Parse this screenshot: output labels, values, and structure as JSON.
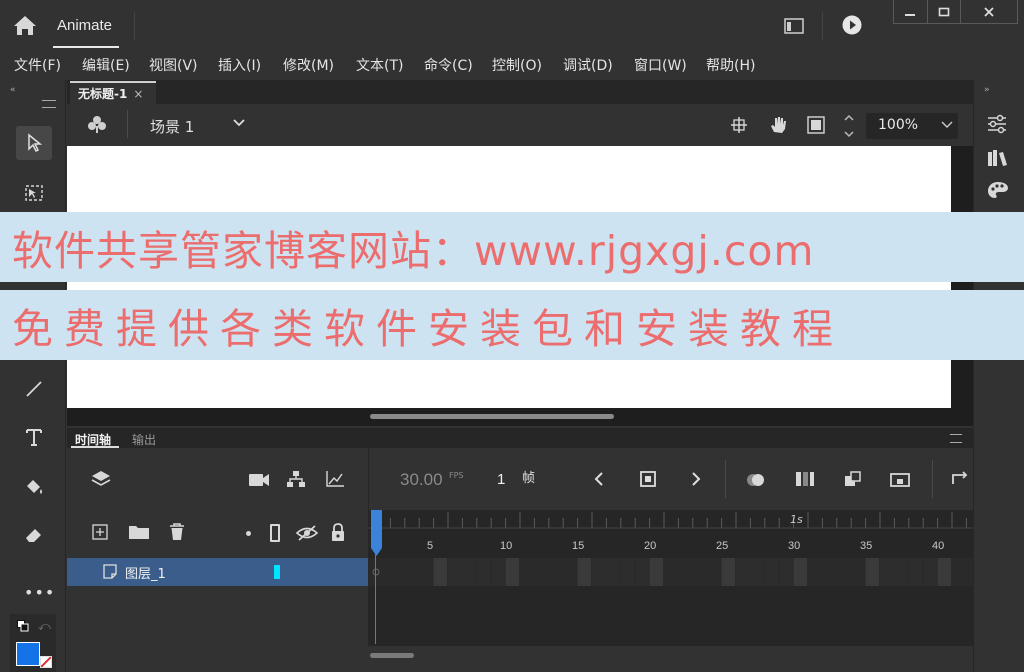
{
  "app": {
    "title": "Animate"
  },
  "menu": [
    "文件(F)",
    "编辑(E)",
    "视图(V)",
    "插入(I)",
    "修改(M)",
    "文本(T)",
    "命令(C)",
    "控制(O)",
    "调试(D)",
    "窗口(W)",
    "帮助(H)"
  ],
  "document": {
    "tab_label": "无标题-1",
    "close_glyph": "×"
  },
  "scene": {
    "label": "场景 1",
    "zoom": "100%"
  },
  "timeline": {
    "tabs": [
      "时间轴",
      "输出"
    ],
    "fps": "30.00",
    "fps_unit": "FPS",
    "current_frame": "1",
    "frame_unit": "帧",
    "second_marker": "1s",
    "ticks": [
      "5",
      "10",
      "15",
      "20",
      "25",
      "30",
      "35",
      "40"
    ],
    "layer_name": "图层_1"
  },
  "watermark": {
    "line1": "软件共享管家博客网站：www.rjgxgj.com",
    "line2": "免费提供各类软件安装包和安装教程"
  },
  "colors": {
    "background": "#323232",
    "dark": "#262626",
    "selection": "#3a5d8c",
    "playhead": "#3b83d9",
    "accent_cyan": "#00e5ff",
    "fill_swatch": "#1473e6",
    "banner_bg": "#cde3f1",
    "banner_text": "#ec6d6d"
  },
  "icons": [
    "home-icon",
    "workspace-icon",
    "play-icon",
    "minimize-icon",
    "maximize-icon",
    "close-icon",
    "selection-tool-icon",
    "free-transform-icon",
    "line-tool-icon",
    "text-tool-icon",
    "paint-bucket-icon",
    "eraser-icon",
    "more-tools-icon",
    "properties-icon",
    "library-icon",
    "swatches-icon"
  ]
}
